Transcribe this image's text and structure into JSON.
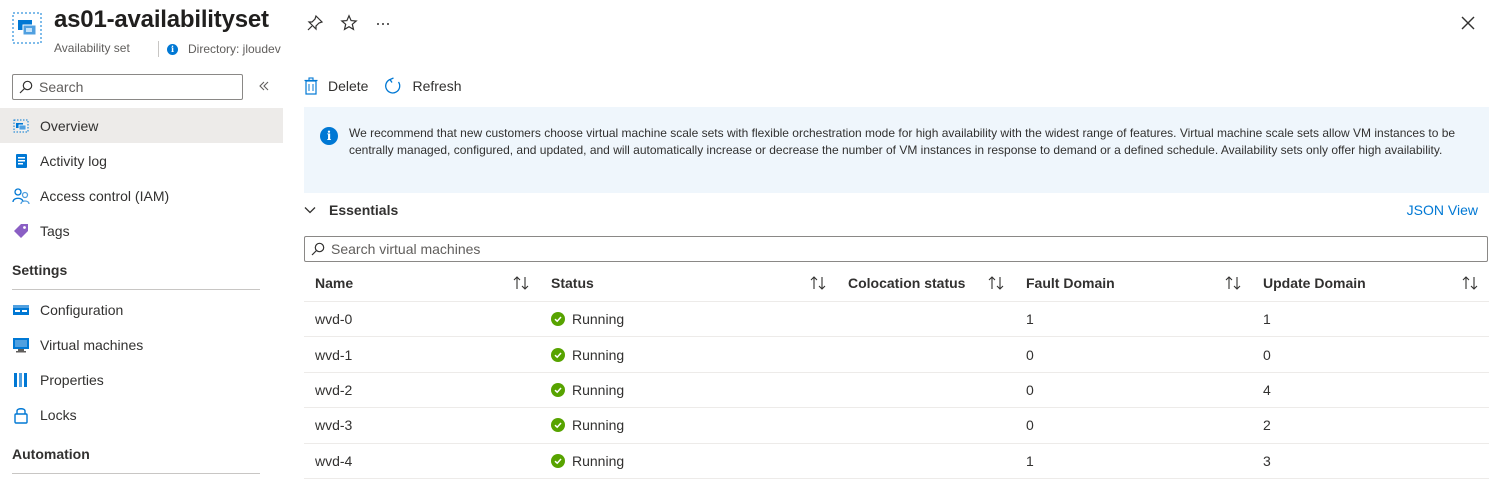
{
  "header": {
    "title": "as01-availabilityset",
    "subtitle": "Availability set",
    "directory": "Directory: jloudev",
    "icons": [
      "availability-set-icon",
      "pin-icon",
      "star-icon",
      "more-icon",
      "close-icon"
    ]
  },
  "sidebar": {
    "search_placeholder": "Search",
    "items": [
      {
        "label": "Overview",
        "icon": "overview-icon",
        "active": true
      },
      {
        "label": "Activity log",
        "icon": "activity-log-icon"
      },
      {
        "label": "Access control (IAM)",
        "icon": "iam-icon"
      },
      {
        "label": "Tags",
        "icon": "tag-icon"
      }
    ],
    "settings_heading": "Settings",
    "settings_items": [
      {
        "label": "Configuration",
        "icon": "configuration-icon"
      },
      {
        "label": "Virtual machines",
        "icon": "virtual-machine-icon"
      },
      {
        "label": "Properties",
        "icon": "properties-icon"
      },
      {
        "label": "Locks",
        "icon": "lock-icon"
      }
    ],
    "automation_heading": "Automation"
  },
  "toolbar": {
    "delete_label": "Delete",
    "refresh_label": "Refresh"
  },
  "info": {
    "message": "We recommend that new customers choose virtual machine scale sets with flexible orchestration mode for high availability with the widest range of features. Virtual machine scale sets allow VM instances to be centrally managed, configured, and updated, and will automatically increase or decrease the number of VM instances in response to demand or a defined schedule. Availability sets only offer high availability."
  },
  "essentials": {
    "label": "Essentials",
    "json_view": "JSON View"
  },
  "vm_search": {
    "placeholder": "Search virtual machines"
  },
  "table": {
    "columns": [
      "Name",
      "Status",
      "Colocation status",
      "Fault Domain",
      "Update Domain"
    ],
    "rows": [
      {
        "name": "wvd-0",
        "status": "Running",
        "colocation": "",
        "fault": "1",
        "update": "1"
      },
      {
        "name": "wvd-1",
        "status": "Running",
        "colocation": "",
        "fault": "0",
        "update": "0"
      },
      {
        "name": "wvd-2",
        "status": "Running",
        "colocation": "",
        "fault": "0",
        "update": "4"
      },
      {
        "name": "wvd-3",
        "status": "Running",
        "colocation": "",
        "fault": "0",
        "update": "2"
      },
      {
        "name": "wvd-4",
        "status": "Running",
        "colocation": "",
        "fault": "1",
        "update": "3"
      }
    ]
  },
  "colors": {
    "accent": "#0078d4",
    "status_running": "#57a300",
    "info_bg": "#eff6fc",
    "nav_active_bg": "#edebe9"
  }
}
